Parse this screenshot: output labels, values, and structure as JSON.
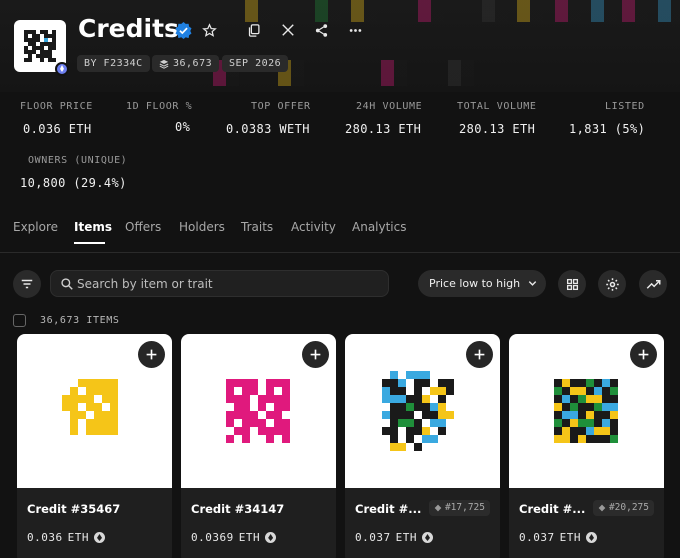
{
  "collection": {
    "title": "Credits",
    "chips": {
      "creator": "BY F2334C",
      "items": "36,673",
      "date": "SEP 2026"
    }
  },
  "stats": [
    {
      "label": "FLOOR PRICE",
      "value": "0.036 ETH"
    },
    {
      "label": "1D FLOOR %",
      "value": "0%"
    },
    {
      "label": "TOP OFFER",
      "value": "0.0383 WETH"
    },
    {
      "label": "24H VOLUME",
      "value": "280.13 ETH"
    },
    {
      "label": "TOTAL VOLUME",
      "value": "280.13 ETH"
    },
    {
      "label": "LISTED",
      "value": "1,831 (5%)"
    },
    {
      "label": "OWNERS (UNIQUE)",
      "value": "10,800 (29.4%)"
    }
  ],
  "tabs": [
    "Explore",
    "Items",
    "Offers",
    "Holders",
    "Traits",
    "Activity",
    "Analytics"
  ],
  "active_tab": "Items",
  "toolbar": {
    "search_placeholder": "Search by item or trait",
    "sort_label": "Price low to high"
  },
  "items_count": "36,673 ITEMS",
  "cards": [
    {
      "name": "Credit #35467",
      "rank": "",
      "price": "0.036",
      "currency": "ETH"
    },
    {
      "name": "Credit #34147",
      "rank": "",
      "price": "0.0369",
      "currency": "ETH"
    },
    {
      "name": "Credit #...",
      "rank": "#17,725",
      "price": "0.037",
      "currency": "ETH"
    },
    {
      "name": "Credit #...",
      "rank": "#20,275",
      "price": "0.037",
      "currency": "ETH"
    }
  ],
  "colors": {
    "background": "#121212",
    "verified": "#2081e2",
    "yellow": "#f5c518",
    "magenta": "#e0197d",
    "sky": "#3aa9e0",
    "green": "#1f8f3a"
  }
}
